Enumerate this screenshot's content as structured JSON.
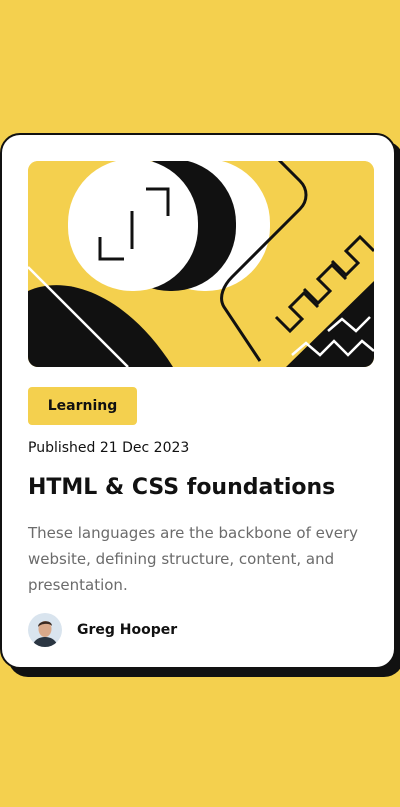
{
  "colors": {
    "background": "#F4D04E",
    "card": "#FFFFFF",
    "ink": "#111111",
    "muted": "#6B6B6B",
    "tag": "#F4D04E"
  },
  "card": {
    "illustration": "abstract-yellow-black-illustration",
    "tag": "Learning",
    "published": "Published 21 Dec 2023",
    "title": "HTML & CSS foundations",
    "description": "These languages are the backbone of every website, defining structure, content, and presentation.",
    "author": {
      "name": "Greg Hooper",
      "avatar_icon": "avatar-photo"
    }
  }
}
